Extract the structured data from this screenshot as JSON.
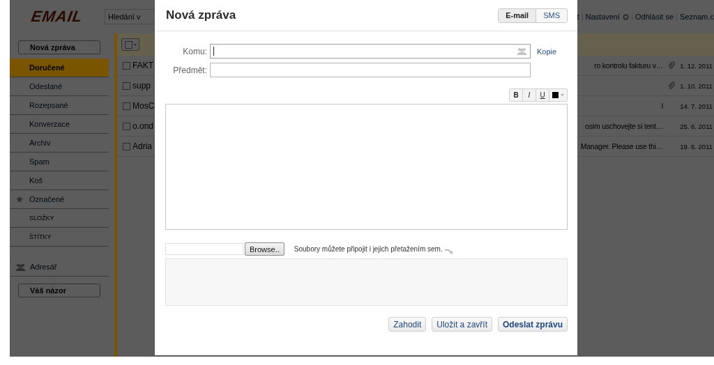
{
  "page": {
    "logo": "EMAIL",
    "search": {
      "placeholder": "Hledání v"
    },
    "top_links": [
      "t",
      "Nastavení",
      "Odhlásit se",
      "Seznam.c"
    ]
  },
  "sidebar": {
    "compose_button": "Nová zpráva",
    "items": [
      {
        "label": "Doručené",
        "selected": true,
        "kind": "folder"
      },
      {
        "label": "Odeslané",
        "selected": false,
        "kind": "folder"
      },
      {
        "label": "Rozepsané",
        "selected": false,
        "kind": "folder"
      },
      {
        "label": "Konverzace",
        "selected": false,
        "kind": "folder"
      },
      {
        "label": "Archiv",
        "selected": false,
        "kind": "folder"
      },
      {
        "label": "Spam",
        "selected": false,
        "kind": "folder"
      },
      {
        "label": "Koš",
        "selected": false,
        "kind": "folder"
      },
      {
        "label": "Označené",
        "selected": false,
        "kind": "starred"
      }
    ],
    "sections": [
      "SLOŽKY",
      "ŠTÍTKY"
    ],
    "address_book": "Adresář",
    "feedback_button": "Váš názor"
  },
  "list": {
    "select_all_checked": false
  },
  "messages": [
    {
      "sender": "FAKT",
      "snippet": "ro kontrolu fakturu v…",
      "attachment": true,
      "date": "1. 12. 2011",
      "checked": false
    },
    {
      "sender": "supp",
      "attachment": true,
      "date": "1. 10. 2011",
      "checked": false
    },
    {
      "sender": "MosC",
      "snippet": "l",
      "attachment": false,
      "date": "14. 7. 2011",
      "checked": false
    },
    {
      "sender": "o.ond",
      "snippet": "osim uschovejte si tent…",
      "attachment": false,
      "date": "25. 6. 2011",
      "checked": false
    },
    {
      "sender": "Adria",
      "snippet": "Manager. Please use thi…",
      "attachment": false,
      "date": "19. 6. 2011",
      "checked": false
    }
  ],
  "dialog": {
    "title": "Nová zpráva",
    "modes": [
      {
        "label": "E-mail",
        "selected": true
      },
      {
        "label": "SMS",
        "selected": false
      }
    ],
    "fields": [
      {
        "label": "Komu:",
        "kind": "recipients",
        "focused": true
      },
      {
        "label": "Předmět:",
        "kind": "subject",
        "focused": false
      }
    ],
    "copy_link": "Kopie",
    "format_buttons": [
      {
        "label": "B",
        "kind": "bold"
      },
      {
        "label": "I",
        "kind": "italic"
      },
      {
        "label": "U",
        "kind": "underline"
      }
    ],
    "browse_button": "Browse..",
    "attach_hint": "Soubory můžete připojit i jejich přetažením sem.",
    "actions": [
      {
        "label": "Zahodit",
        "primary": false
      },
      {
        "label": "Uložit a zavřít",
        "primary": false
      },
      {
        "label": "Odeslat zprávu",
        "primary": true
      }
    ]
  }
}
